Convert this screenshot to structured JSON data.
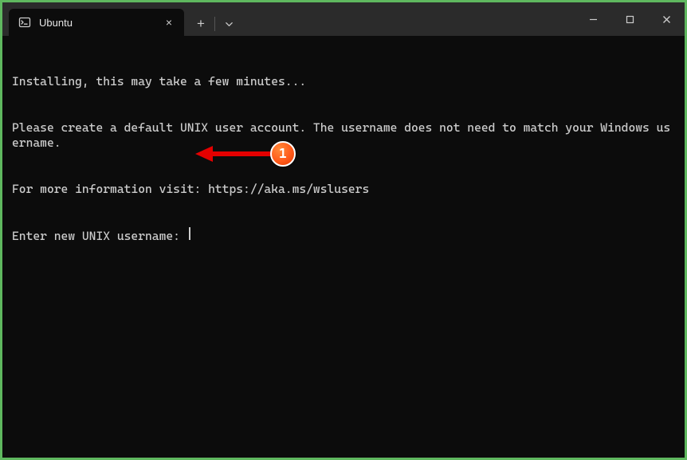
{
  "tab": {
    "title": "Ubuntu",
    "icon_name": "terminal-icon"
  },
  "titlebar": {
    "new_tab": "+",
    "dropdown": "⌄",
    "close_tab": "×"
  },
  "terminal": {
    "lines": [
      "Installing, this may take a few minutes...",
      "Please create a default UNIX user account. The username does not need to match your Windows username.",
      "For more information visit: https://aka.ms/wslusers"
    ],
    "prompt": "Enter new UNIX username: ",
    "input_value": ""
  },
  "annotation": {
    "badge_number": "1"
  }
}
